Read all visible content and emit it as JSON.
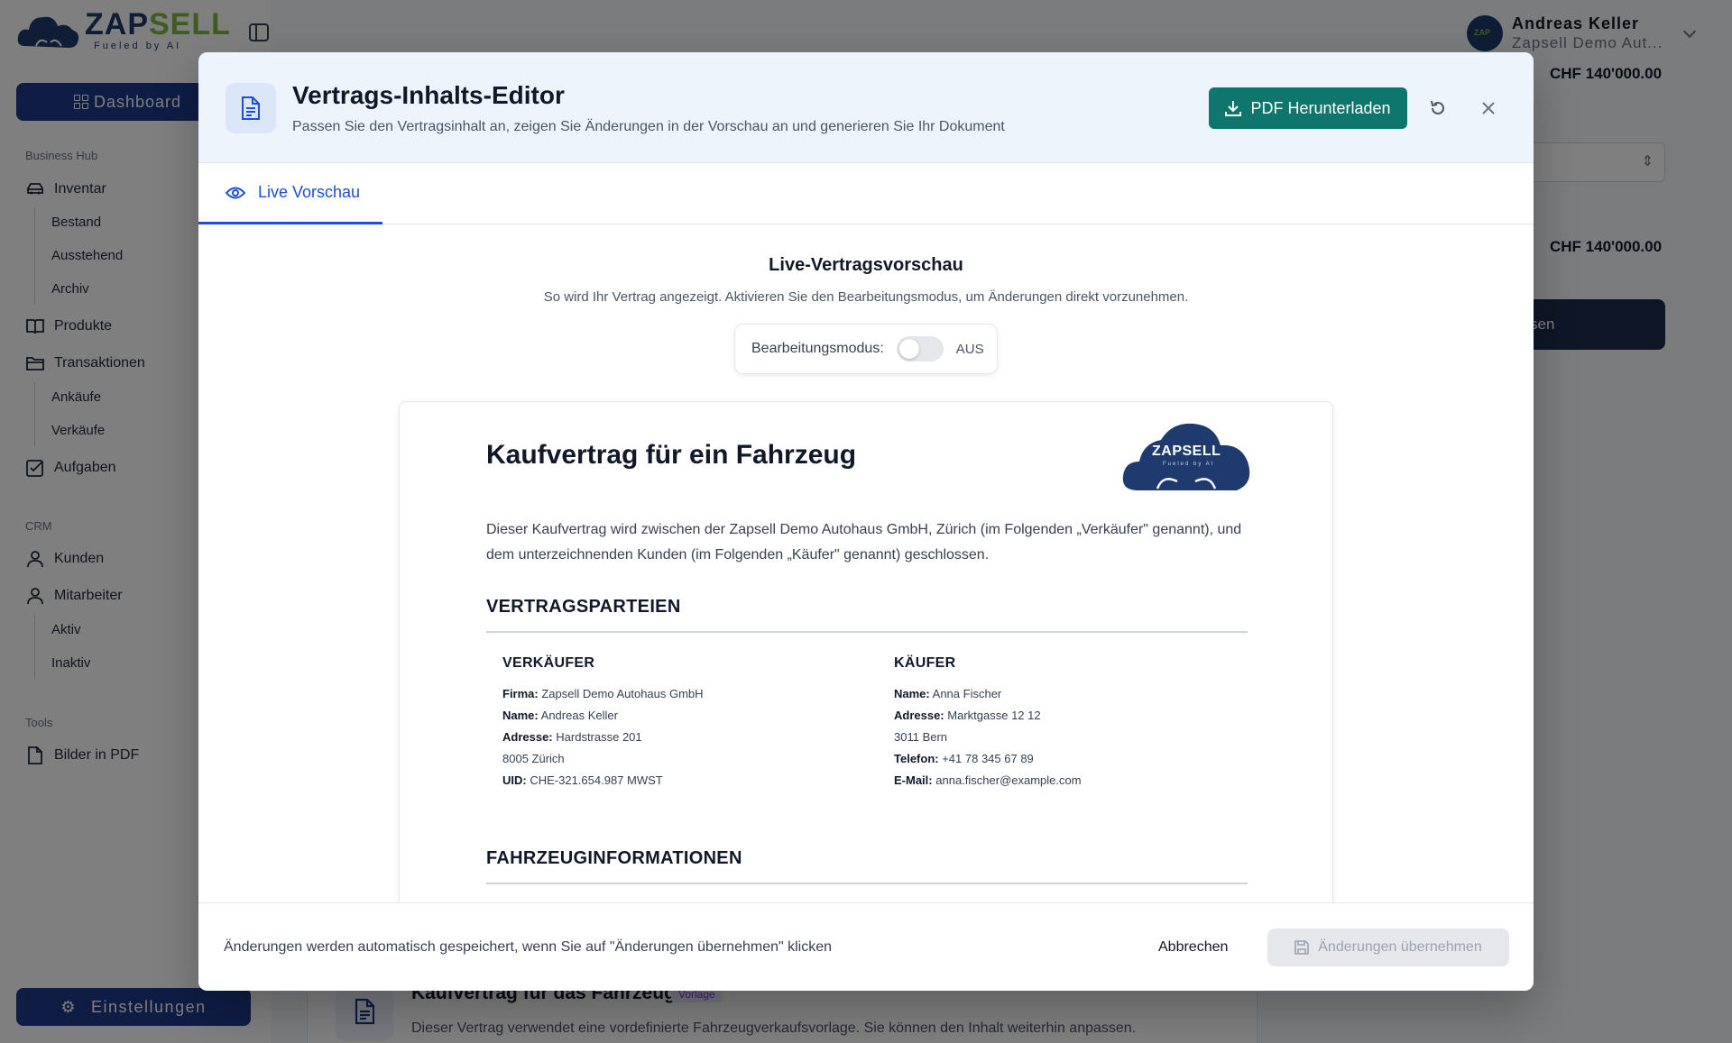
{
  "app": {
    "logo": {
      "word_a": "ZAP",
      "word_b": "SELL",
      "tagline": "Fueled by AI"
    },
    "dashboard_label": "Dashboard",
    "sidebar": {
      "section_business": "Business Hub",
      "inventar": "Inventar",
      "bestand": "Bestand",
      "ausstehend": "Ausstehend",
      "archiv": "Archiv",
      "produkte": "Produkte",
      "transaktionen": "Transaktionen",
      "ankaeufe": "Ankäufe",
      "verkaeufe": "Verkäufe",
      "aufgaben": "Aufgaben",
      "section_crm": "CRM",
      "kunden": "Kunden",
      "mitarbeiter": "Mitarbeiter",
      "aktiv": "Aktiv",
      "inaktiv": "Inaktiv",
      "section_tools": "Tools",
      "bilder_pdf": "Bilder in PDF"
    },
    "settings_label": "Einstellungen",
    "user": {
      "name": "Andreas Keller",
      "company": "Zapsell Demo Aut..."
    },
    "bg_price_1": "CHF 140'000.00",
    "bg_price_2": "CHF 140'000.00",
    "bg_button_fragment": "sen",
    "bg_card": {
      "title": "Kaufvertrag für das Fahrzeug",
      "badge": "Vorlage",
      "description": "Dieser Vertrag verwendet eine vordefinierte Fahrzeugverkaufsvorlage. Sie können den Inhalt weiterhin anpassen."
    }
  },
  "modal": {
    "title": "Vertrags-Inhalts-Editor",
    "subtitle": "Passen Sie den Vertragsinhalt an, zeigen Sie Änderungen in der Vorschau an und generieren Sie Ihr Dokument",
    "pdf_button": "PDF Herunterladen",
    "tab_label": "Live Vorschau",
    "preview_title": "Live-Vertragsvorschau",
    "preview_subtitle": "So wird Ihr Vertrag angezeigt. Aktivieren Sie den Bearbeitungsmodus, um Änderungen direkt vorzunehmen.",
    "edit_mode_label": "Bearbeitungsmodus:",
    "edit_mode_state": "AUS",
    "edit_mode_on": false,
    "footer_note": "Änderungen werden automatisch gespeichert, wenn Sie auf \"Änderungen übernehmen\" klicken",
    "cancel_label": "Abbrechen",
    "apply_label": "Änderungen übernehmen"
  },
  "document": {
    "title": "Kaufvertrag für ein Fahrzeug",
    "logo_text": "ZAPSELL",
    "logo_tagline": "Fueled by AI",
    "intro": "Dieser Kaufvertrag wird zwischen der Zapsell Demo Autohaus GmbH, Zürich (im Folgenden „Verkäufer\" genannt), und dem unterzeichnenden Kunden (im Folgenden „Käufer\" genannt) geschlossen.",
    "section_parties": "VERTRAGSPARTEIEN",
    "seller": {
      "heading": "VERKÄUFER",
      "firma_label": "Firma:",
      "firma": "Zapsell Demo Autohaus GmbH",
      "name_label": "Name:",
      "name": "Andreas Keller",
      "adresse_label": "Adresse:",
      "adresse": "Hardstrasse 201",
      "ort": "8005 Zürich",
      "uid_label": "UID:",
      "uid": "CHE-321.654.987 MWST"
    },
    "buyer": {
      "heading": "KÄUFER",
      "name_label": "Name:",
      "name": "Anna Fischer",
      "adresse_label": "Adresse:",
      "adresse": "Marktgasse 12 12",
      "ort": "3011 Bern",
      "telefon_label": "Telefon:",
      "telefon": "+41 78 345 67 89",
      "email_label": "E-Mail:",
      "email": "anna.fischer@example.com"
    },
    "section_vehicle": "FAHRZEUGINFORMATIONEN"
  },
  "colors": {
    "primary_navy": "#1e3a8a",
    "teal_button": "#0f766e",
    "tab_blue": "#1d4ed8",
    "logo_green": "#7fb843"
  }
}
